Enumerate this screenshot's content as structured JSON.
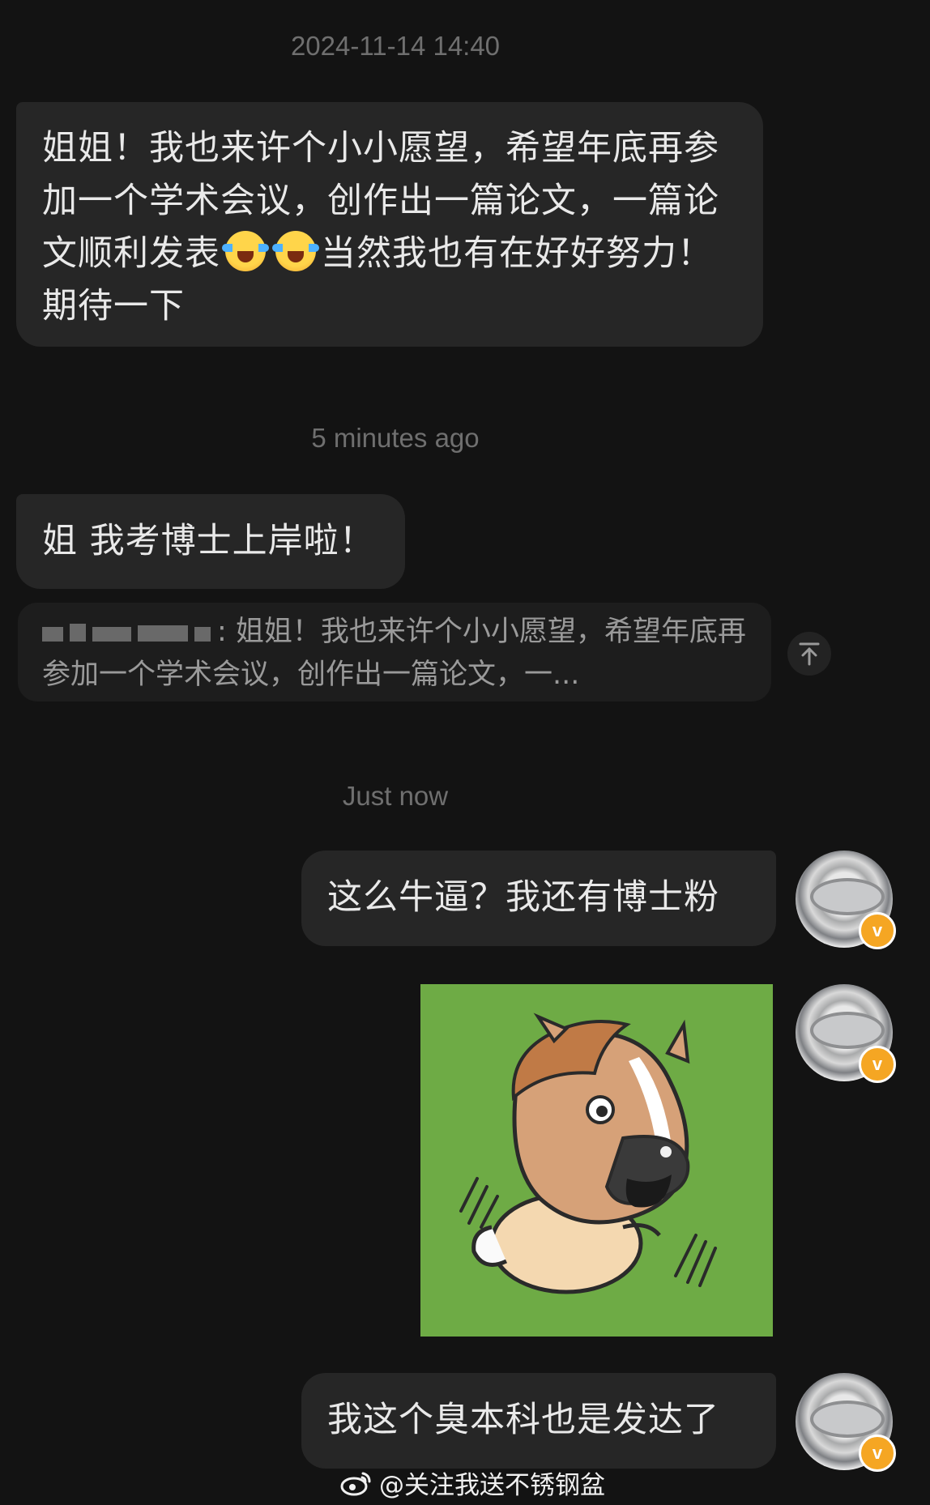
{
  "timestamps": {
    "first": "2024-11-14 14:40",
    "second": "5 minutes ago",
    "third": "Just now"
  },
  "messages": {
    "incoming_1_part1": "姐姐！我也来许个小小愿望，希望年底再参加一个学术会议，创作出一篇论文，一篇论文顺利发表",
    "incoming_1_part2": "当然我也有在好好努力！期待一下",
    "incoming_2": "姐 我考博士上岸啦！",
    "quote_text": ": 姐姐！我也来许个小小愿望，希望年底再参加一个学术会议，创作出一篇论文，一...",
    "outgoing_1": "这么牛逼？我还有博士粉",
    "outgoing_3": "我这个臭本科也是发达了"
  },
  "footer": {
    "watermark": "@关注我送不锈钢盆"
  },
  "icons": {
    "emoji": "loudly-laughing-face-emoji",
    "scroll_top": "arrow-up-to-top-icon",
    "verified": "v"
  },
  "colors": {
    "background": "#131313",
    "bubble": "#262626",
    "verified_badge": "#f5a623",
    "sticker_bg": "#6eab45"
  }
}
